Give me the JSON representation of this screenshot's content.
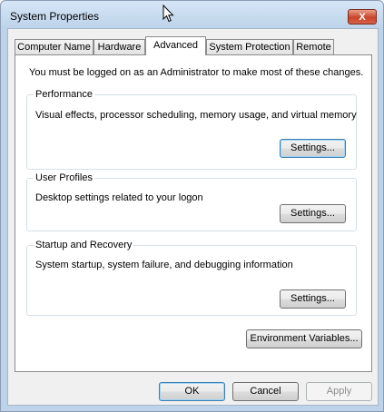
{
  "window": {
    "title": "System Properties",
    "close_glyph": "X"
  },
  "tabs": [
    {
      "label": "Computer Name",
      "active": false
    },
    {
      "label": "Hardware",
      "active": false
    },
    {
      "label": "Advanced",
      "active": true
    },
    {
      "label": "System Protection",
      "active": false
    },
    {
      "label": "Remote",
      "active": false
    }
  ],
  "advanced": {
    "intro": "You must be logged on as an Administrator to make most of these changes.",
    "performance": {
      "title": "Performance",
      "description": "Visual effects, processor scheduling, memory usage, and virtual memory",
      "button": "Settings..."
    },
    "user_profiles": {
      "title": "User Profiles",
      "description": "Desktop settings related to your logon",
      "button": "Settings..."
    },
    "startup_recovery": {
      "title": "Startup and Recovery",
      "description": "System startup, system failure, and debugging information",
      "button": "Settings..."
    },
    "env_button": "Environment Variables..."
  },
  "footer": {
    "ok": "OK",
    "cancel": "Cancel",
    "apply": "Apply"
  },
  "icons": {
    "cursor": "mouse-pointer-icon"
  }
}
